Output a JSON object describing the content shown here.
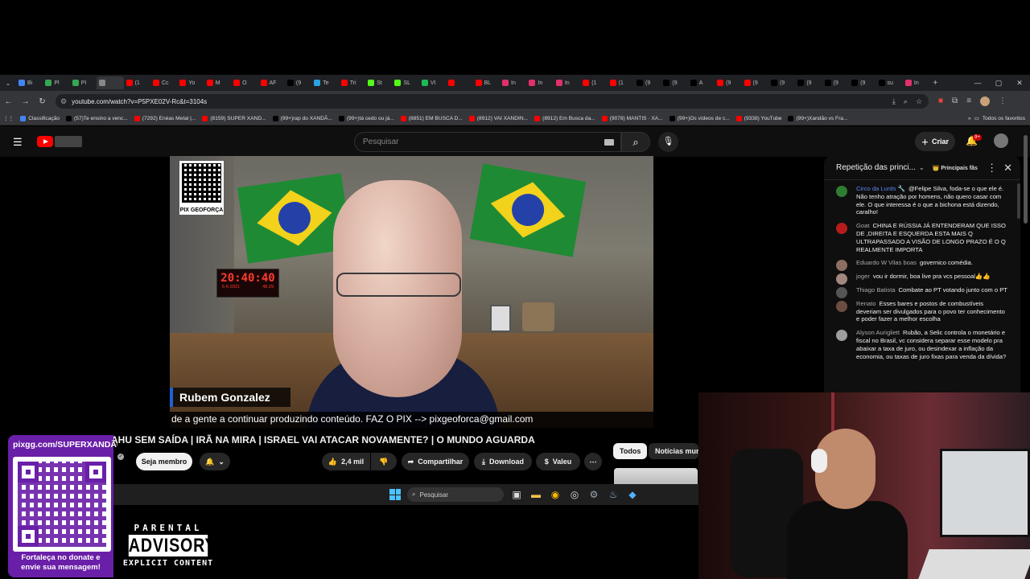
{
  "browser": {
    "tabs": [
      {
        "label": "Bi",
        "color": "#4285f4"
      },
      {
        "label": "Pl",
        "color": "#34a853"
      },
      {
        "label": "Pl",
        "color": "#34a853"
      },
      {
        "label": "",
        "color": "#888888"
      },
      {
        "label": "(1",
        "color": "#ff0000"
      },
      {
        "label": "Cc",
        "color": "#ff0000"
      },
      {
        "label": "Yo",
        "color": "#ff0000"
      },
      {
        "label": "M",
        "color": "#ff0000"
      },
      {
        "label": "O",
        "color": "#ff0000"
      },
      {
        "label": "AF",
        "color": "#ff0000"
      },
      {
        "label": "(9",
        "color": "#000000"
      },
      {
        "label": "Te",
        "color": "#2aa3e0"
      },
      {
        "label": "Tri",
        "color": "#ff0000"
      },
      {
        "label": "St",
        "color": "#53fc18"
      },
      {
        "label": "SL",
        "color": "#53fc18"
      },
      {
        "label": "VI",
        "color": "#1db954"
      },
      {
        "label": "",
        "color": "#ff0000"
      },
      {
        "label": "BL",
        "color": "#ff0000"
      },
      {
        "label": "In",
        "color": "#e1306c"
      },
      {
        "label": "In",
        "color": "#e1306c"
      },
      {
        "label": "In",
        "color": "#e1306c"
      },
      {
        "label": "(1",
        "color": "#ff0000"
      },
      {
        "label": "(1",
        "color": "#ff0000"
      },
      {
        "label": "(9",
        "color": "#000000"
      },
      {
        "label": "(9",
        "color": "#000000"
      },
      {
        "label": "A",
        "color": "#000000"
      },
      {
        "label": "(9",
        "color": "#ff0000"
      },
      {
        "label": "(9",
        "color": "#ff0000"
      },
      {
        "label": "(9",
        "color": "#000000"
      },
      {
        "label": "(9",
        "color": "#000000"
      },
      {
        "label": "(9",
        "color": "#000000"
      },
      {
        "label": "(9",
        "color": "#000000"
      },
      {
        "label": "su",
        "color": "#000000"
      },
      {
        "label": "In",
        "color": "#e1306c"
      }
    ],
    "url": "youtube.com/watch?v=P5PXE02V-Rc&t=3104s",
    "bookmarks": [
      {
        "label": "Classificação",
        "color": "#4285f4"
      },
      {
        "label": "(57)Te ensino a venc...",
        "color": "#000000"
      },
      {
        "label": "(7292) Enéas Metal |...",
        "color": "#ff0000"
      },
      {
        "label": "(8159) SUPER XAND...",
        "color": "#ff0000"
      },
      {
        "label": "(99+)rap do XANDÃ...",
        "color": "#000000"
      },
      {
        "label": "(99+)tá cedo ou já...",
        "color": "#000000"
      },
      {
        "label": "(8851) EM BUSCA D...",
        "color": "#ff0000"
      },
      {
        "label": "(8912) VAI XANDIN...",
        "color": "#ff0000"
      },
      {
        "label": "(8912) Em Busca da...",
        "color": "#ff0000"
      },
      {
        "label": "(9078) MANTIS · XA...",
        "color": "#ff0000"
      },
      {
        "label": "(99+)Os vídeos de c...",
        "color": "#000000"
      },
      {
        "label": "(9338) YouTube",
        "color": "#ff0000"
      },
      {
        "label": "(99+)Xandão vs Fra...",
        "color": "#000000"
      }
    ],
    "all_favorites": "Todos os favoritos"
  },
  "youtube": {
    "search_placeholder": "Pesquisar",
    "create_label": "Criar",
    "notifications_badge": "9+",
    "video": {
      "qr_label": "PIX GEOFORÇA",
      "clock_time": "20:40:40",
      "clock_date": "5·6·2021",
      "clock_temp": "48.29",
      "presenter_name": "Rubem Gonzalez",
      "ticker": "de a gente a continuar produzindo conteúdo. FAZ O PIX --> pixgeoforca@gmail.com"
    },
    "title": "AHU SEM SAÍDA | IRÃ NA MIRA | ISRAEL VAI ATACAR NOVAMENTE? | O MUNDO AGUARDA",
    "join_label": "Seja membro",
    "like_count": "2,4 mil",
    "share_label": "Compartilhar",
    "download_label": "Download",
    "thanks_label": "Valeu",
    "chips": [
      "Todos",
      "Notícias mundi"
    ]
  },
  "chat": {
    "header": "Repetição das princi...",
    "channel_badge": "Principais fãs",
    "messages": [
      {
        "author": "Circo da Lurds",
        "mod": true,
        "avatar": "#2e7d32",
        "text": "@Felipe Silva, foda-se o que ele é. Não tenho atração por homens, não quero casar com ele. O que interessa é o que a bichona está dizendo, caralho!"
      },
      {
        "author": "Goat",
        "mod": false,
        "avatar": "#b71c1c",
        "text": "CHINA E RÚSSIA JÁ ENTENDERAM QUE ISSO DE ,DIREITA E ESQUERDA ESTA MAIS Q ULTRAPASSADO A VISÃO DE LONGO PRAZO É O Q REALMENTE IMPORTA"
      },
      {
        "author": "Eduardo W Vilas boas",
        "mod": false,
        "avatar": "#8d6e63",
        "text": "governico comédia."
      },
      {
        "author": "joger",
        "mod": false,
        "avatar": "#a1887f",
        "text": "vou ir dormir, boa live pra vcs pessoal👍👍"
      },
      {
        "author": "Thiago Batista",
        "mod": false,
        "avatar": "#555555",
        "text": "Combate ao PT votando junto com o PT"
      },
      {
        "author": "Renato",
        "mod": false,
        "avatar": "#6d4c41",
        "text": "Esses bares e postos de combustíveis deveriam ser divulgados para o povo ter conhecimento e poder fazer a melhor escolha"
      },
      {
        "author": "Alyson Aurigliett",
        "mod": false,
        "avatar": "#9e9e9e",
        "text": "Rubão, a Selic controla o monetário e fiscal no Brasil, vc considera separar esse modelo pra abaixar a taxa de juro, ou desindexar a inflação da economia, ou taxas de juro fixas para venda da dívida?"
      }
    ]
  },
  "taskbar": {
    "search_placeholder": "Pesquisar"
  },
  "overlay": {
    "pix_url": "pixgg.com/SUPERXANDÃO",
    "pix_message_1": "Fortaleça no donate e",
    "pix_message_2": "envie sua mensagem!",
    "advisory_top": "PARENTAL",
    "advisory_mid": "ADVISORY",
    "advisory_bottom": "EXPLICIT CONTENT"
  }
}
